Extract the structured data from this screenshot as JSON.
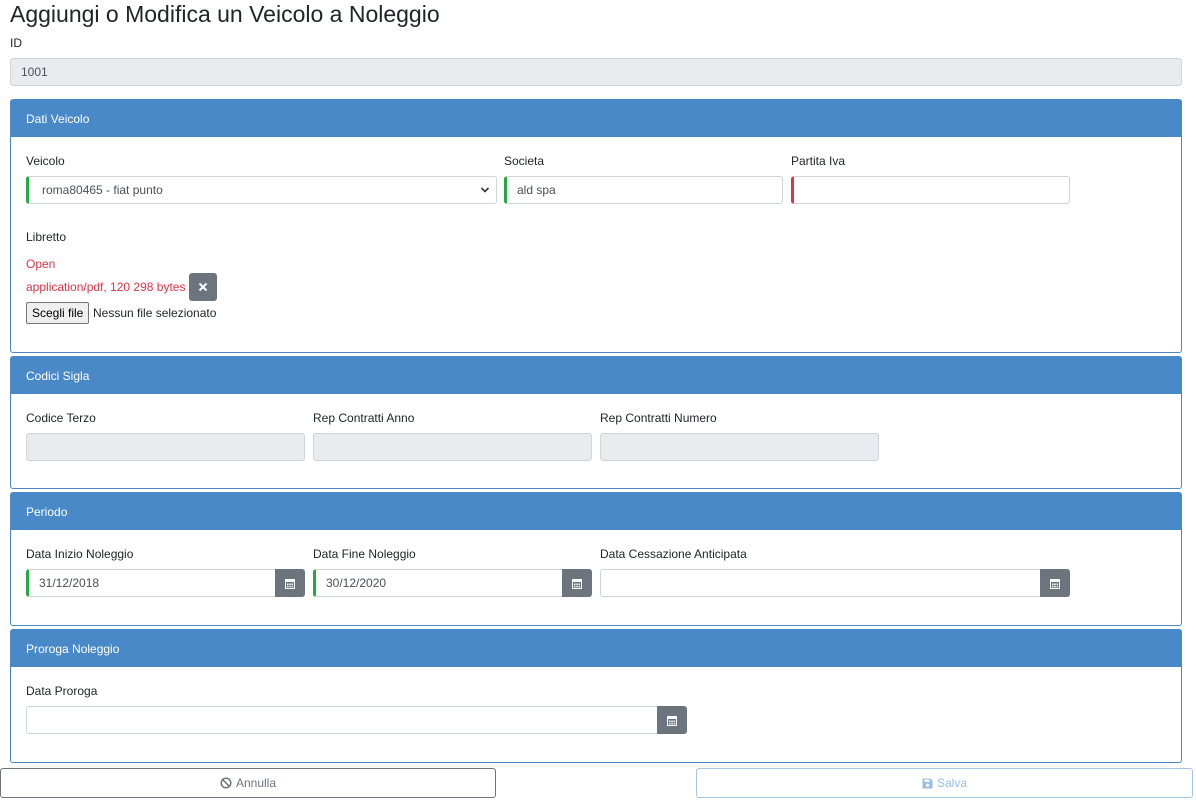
{
  "page": {
    "title": "Aggiungi o Modifica un Veicolo a Noleggio"
  },
  "id_field": {
    "label": "ID",
    "value": "1001"
  },
  "dati_veicolo": {
    "header": "Dati Veicolo",
    "veicolo": {
      "label": "Veicolo",
      "value": "roma80465 - fiat punto"
    },
    "societa": {
      "label": "Societa",
      "value": "ald spa"
    },
    "partita_iva": {
      "label": "Partita Iva",
      "value": ""
    },
    "libretto": {
      "label": "Libretto",
      "open_link": "Open",
      "file_info": "application/pdf, 120 298 bytes",
      "choose_button": "Scegli file",
      "no_file_text": "Nessun file selezionato"
    }
  },
  "codici_sigla": {
    "header": "Codici Sigla",
    "codice_terzo": {
      "label": "Codice Terzo",
      "value": ""
    },
    "rep_contratti_anno": {
      "label": "Rep Contratti Anno",
      "value": ""
    },
    "rep_contratti_numero": {
      "label": "Rep Contratti Numero",
      "value": ""
    }
  },
  "periodo": {
    "header": "Periodo",
    "data_inizio": {
      "label": "Data Inizio Noleggio",
      "value": "31/12/2018"
    },
    "data_fine": {
      "label": "Data Fine Noleggio",
      "value": "30/12/2020"
    },
    "data_cessazione": {
      "label": "Data Cessazione Anticipata",
      "value": ""
    }
  },
  "proroga": {
    "header": "Proroga Noleggio",
    "data_proroga": {
      "label": "Data Proroga",
      "value": ""
    }
  },
  "actions": {
    "cancel_label": "Annulla",
    "save_label": "Salva"
  },
  "icons": {
    "calendar": "calendar-icon",
    "select_arrow": "chevron-down-icon",
    "remove": "close-icon",
    "cancel": "ban-icon",
    "save": "floppy-disk-icon"
  },
  "colors": {
    "panel_header": "#4a89c8",
    "valid_border": "#28a745",
    "invalid_border": "#dc3545",
    "secondary": "#6c757d"
  }
}
